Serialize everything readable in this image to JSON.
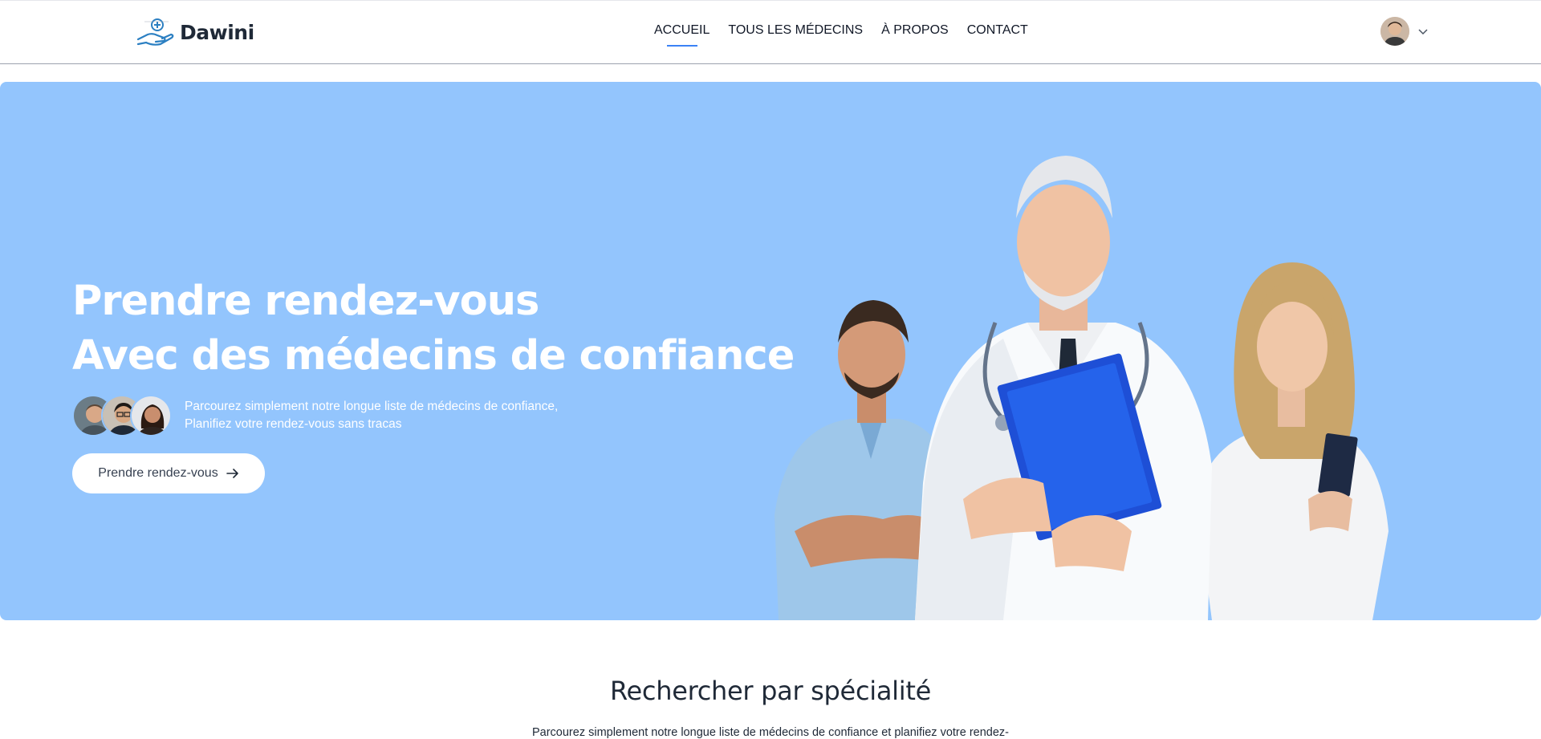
{
  "brand": {
    "name": "Dawini",
    "logo_icon": "hand-holding-medical-icon"
  },
  "nav": {
    "items": [
      {
        "label": "ACCUEIL",
        "active": true
      },
      {
        "label": "TOUS LES MÉDECINS",
        "active": false
      },
      {
        "label": "À PROPOS",
        "active": false
      },
      {
        "label": "CONTACT",
        "active": false
      }
    ]
  },
  "profile": {
    "avatar": "user-avatar",
    "menu_icon": "chevron-down-icon"
  },
  "hero": {
    "title_line1": "Prendre rendez-vous",
    "title_line2": "Avec des médecins de confiance",
    "subtitle_line1": "Parcourez simplement notre longue liste de médecins de confiance,",
    "subtitle_line2": "Planifiez votre rendez-vous sans tracas",
    "cta_label": "Prendre rendez-vous",
    "cta_icon": "arrow-right-icon",
    "background_color": "#93c5fd"
  },
  "speciality": {
    "title": "Rechercher par spécialité",
    "description": "Parcourez simplement notre longue liste de médecins de confiance et planifiez votre rendez-"
  },
  "colors": {
    "accent": "#3b82f6",
    "hero_bg": "#93c5fd",
    "text_dark": "#1f2937"
  }
}
